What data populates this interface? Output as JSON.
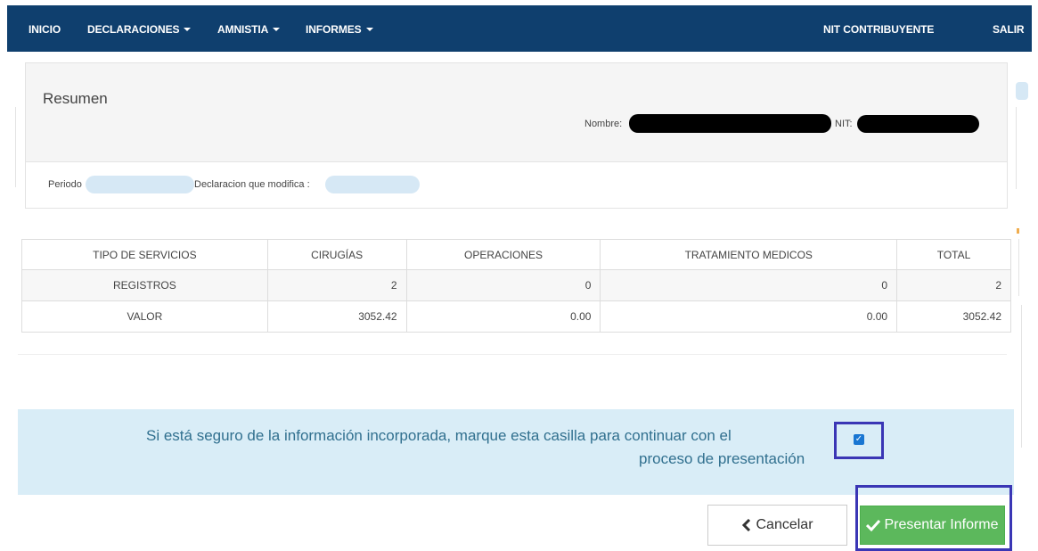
{
  "navbar": {
    "items": [
      {
        "label": "INICIO",
        "dropdown": false
      },
      {
        "label": "DECLARACIONES",
        "dropdown": true
      },
      {
        "label": "AMNISTIA",
        "dropdown": true
      },
      {
        "label": "INFORMES",
        "dropdown": true
      }
    ],
    "contribuyente": "NIT CONTRIBUYENTE",
    "salir": "SALIR",
    "background_color": "#0f3f6e"
  },
  "summary": {
    "title": "Resumen",
    "nombre_label": "Nombre:",
    "nit_label": "NIT:",
    "periodo_label": "Periodo",
    "declaracion_label": "Declaracion que modifica :"
  },
  "table": {
    "headers": [
      "TIPO DE SERVICIOS",
      "CIRUGÍAS",
      "OPERACIONES",
      "TRATAMIENTO MEDICOS",
      "TOTAL"
    ],
    "rows": [
      [
        "REGISTROS",
        "2",
        "0",
        "0",
        "2"
      ],
      [
        "VALOR",
        "3052.42",
        "0.00",
        "0.00",
        "3052.42"
      ]
    ]
  },
  "confirm": {
    "line1": "Si está seguro de la información incorporada, marque esta casilla para continuar con el",
    "line2": "proceso de presentación",
    "checked": true,
    "alert_color": "#d9edf7"
  },
  "buttons": {
    "cancel_label": "Cancelar",
    "cancel_icon": "chevron-left-icon",
    "submit_label": "Presentar Informe",
    "submit_icon": "check-icon",
    "submit_color": "#5cb85c",
    "highlight_color": "#3a36b5"
  }
}
